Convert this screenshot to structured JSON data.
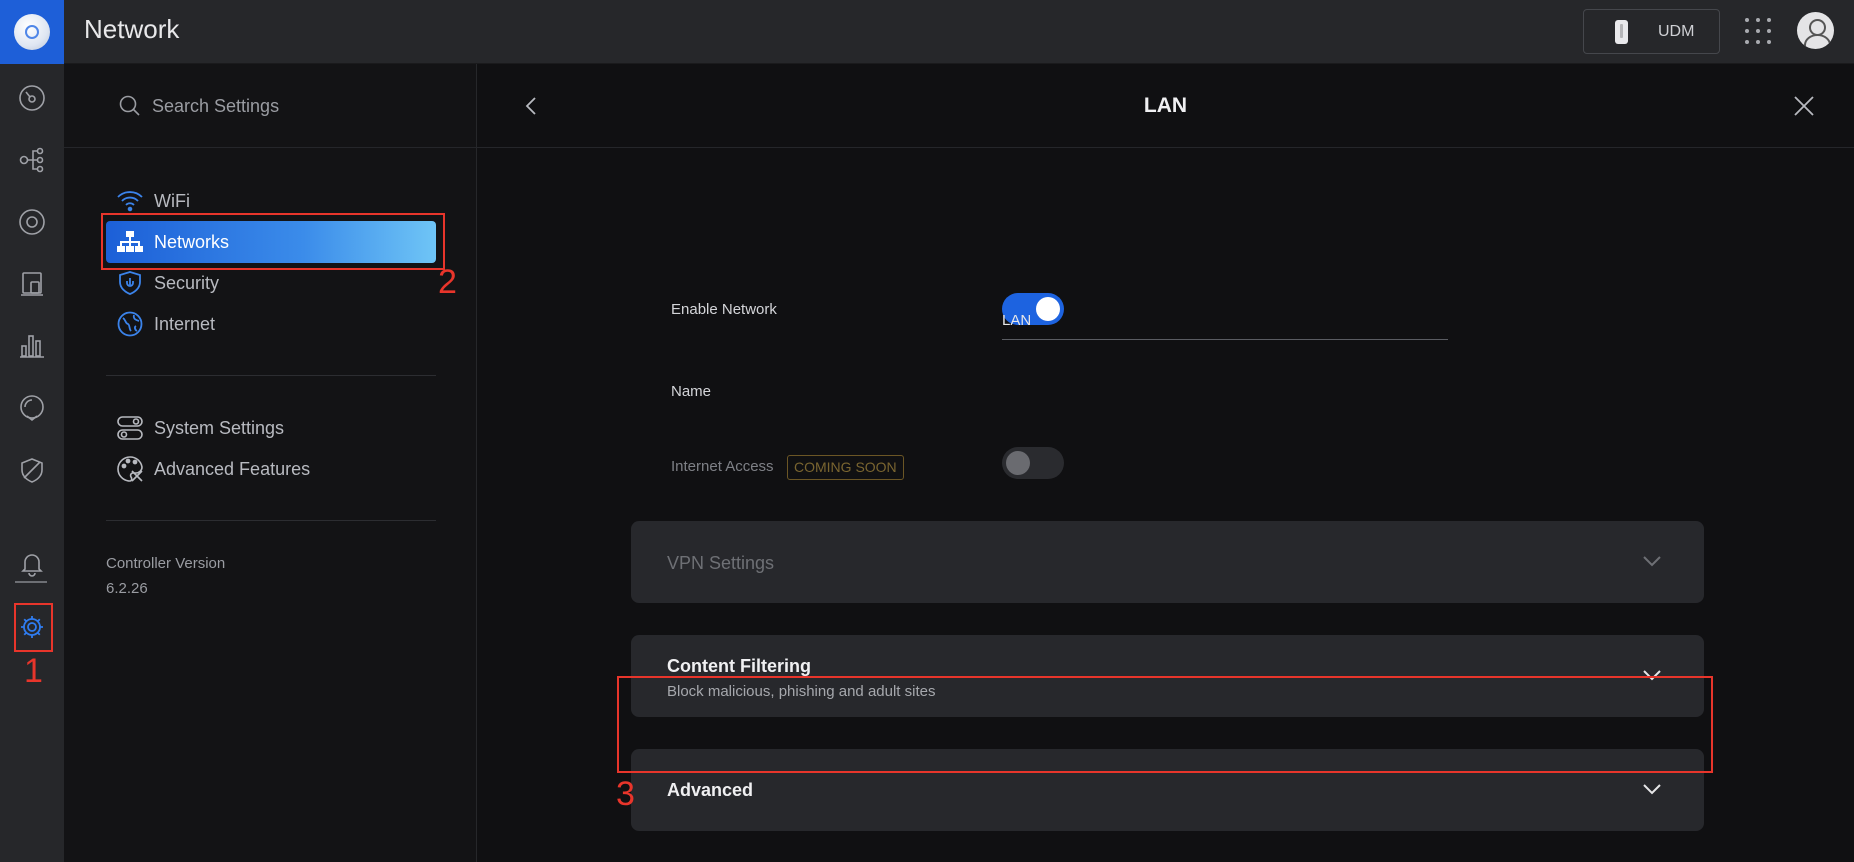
{
  "app": {
    "title": "Network",
    "device_label": "UDM"
  },
  "sidebar": {
    "search_placeholder": "Search Settings",
    "items": [
      {
        "label": "WiFi",
        "icon": "wifi-icon"
      },
      {
        "label": "Networks",
        "icon": "network-topology-icon",
        "active": true
      },
      {
        "label": "Security",
        "icon": "shield-icon"
      },
      {
        "label": "Internet",
        "icon": "globe-icon"
      },
      {
        "label": "System Settings",
        "icon": "toggles-icon"
      },
      {
        "label": "Advanced Features",
        "icon": "palette-tools-icon"
      }
    ],
    "controller_version_label": "Controller Version",
    "controller_version": "6.2.26"
  },
  "main": {
    "title": "LAN",
    "enable_network_label": "Enable Network",
    "enable_network_on": true,
    "name_label": "Name",
    "name_value": "LAN",
    "internet_access_label": "Internet Access",
    "coming_soon_badge": "COMING SOON",
    "internet_access_on": false,
    "sections": [
      {
        "title": "VPN Settings",
        "subtitle": "",
        "disabled": true
      },
      {
        "title": "Content Filtering",
        "subtitle": "Block malicious, phishing and adult sites",
        "disabled": false
      },
      {
        "title": "Advanced",
        "subtitle": "",
        "disabled": false
      }
    ]
  },
  "annotations": [
    "1",
    "2",
    "3"
  ],
  "colors": {
    "accent": "#1d63e0",
    "annotation": "#e8352b",
    "topbar": "#26272a",
    "background": "#101012"
  }
}
